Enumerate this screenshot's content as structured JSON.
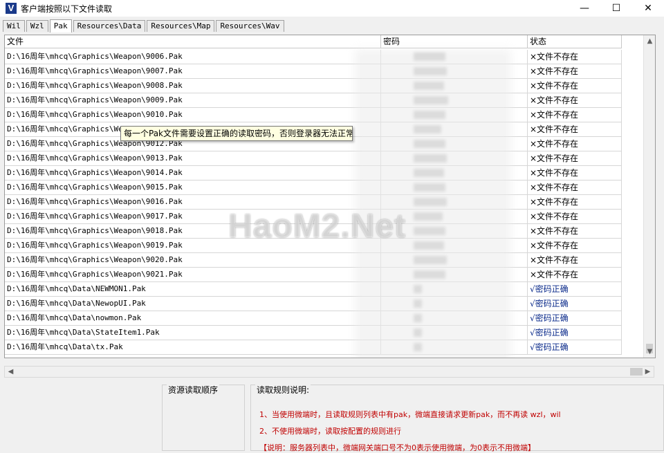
{
  "window": {
    "icon_letter": "V",
    "title": "客户端按照以下文件读取",
    "minimize": "—",
    "maximize": "☐",
    "close": "✕"
  },
  "tabs": [
    {
      "label": "Wil",
      "active": false
    },
    {
      "label": "Wzl",
      "active": false
    },
    {
      "label": "Pak",
      "active": true
    },
    {
      "label": "Resources\\Data",
      "active": false
    },
    {
      "label": "Resources\\Map",
      "active": false
    },
    {
      "label": "Resources\\Wav",
      "active": false
    }
  ],
  "table": {
    "columns": [
      "文件",
      "密码",
      "状态"
    ],
    "rows": [
      {
        "file": "D:\\16周年\\mhcq\\Graphics\\Weapon\\9006.Pak",
        "status": "×文件不存在"
      },
      {
        "file": "D:\\16周年\\mhcq\\Graphics\\Weapon\\9007.Pak",
        "status": "×文件不存在"
      },
      {
        "file": "D:\\16周年\\mhcq\\Graphics\\Weapon\\9008.Pak",
        "status": "×文件不存在"
      },
      {
        "file": "D:\\16周年\\mhcq\\Graphics\\Weapon\\9009.Pak",
        "status": "×文件不存在"
      },
      {
        "file": "D:\\16周年\\mhcq\\Graphics\\Weapon\\9010.Pak",
        "status": "×文件不存在"
      },
      {
        "file": "D:\\16周年\\mhcq\\Graphics\\Weapon\\9011.Pak",
        "status": "×文件不存在"
      },
      {
        "file": "D:\\16周年\\mhcq\\Graphics\\Weapon\\9012.Pak",
        "status": "×文件不存在"
      },
      {
        "file": "D:\\16周年\\mhcq\\Graphics\\Weapon\\9013.Pak",
        "status": "×文件不存在"
      },
      {
        "file": "D:\\16周年\\mhcq\\Graphics\\Weapon\\9014.Pak",
        "status": "×文件不存在"
      },
      {
        "file": "D:\\16周年\\mhcq\\Graphics\\Weapon\\9015.Pak",
        "status": "×文件不存在"
      },
      {
        "file": "D:\\16周年\\mhcq\\Graphics\\Weapon\\9016.Pak",
        "status": "×文件不存在"
      },
      {
        "file": "D:\\16周年\\mhcq\\Graphics\\Weapon\\9017.Pak",
        "status": "×文件不存在"
      },
      {
        "file": "D:\\16周年\\mhcq\\Graphics\\Weapon\\9018.Pak",
        "status": "×文件不存在"
      },
      {
        "file": "D:\\16周年\\mhcq\\Graphics\\Weapon\\9019.Pak",
        "status": "×文件不存在"
      },
      {
        "file": "D:\\16周年\\mhcq\\Graphics\\Weapon\\9020.Pak",
        "status": "×文件不存在"
      },
      {
        "file": "D:\\16周年\\mhcq\\Graphics\\Weapon\\9021.Pak",
        "status": "×文件不存在"
      },
      {
        "file": "D:\\16周年\\mhcq\\Data\\NEWMON1.Pak",
        "status": "√密码正确"
      },
      {
        "file": "D:\\16周年\\mhcq\\Data\\NewopUI.Pak",
        "status": "√密码正确"
      },
      {
        "file": "D:\\16周年\\mhcq\\Data\\nowmon.Pak",
        "status": "√密码正确"
      },
      {
        "file": "D:\\16周年\\mhcq\\Data\\StateItem1.Pak",
        "status": "√密码正确"
      },
      {
        "file": "D:\\16周年\\mhcq\\Data\\tx.Pak",
        "status": "√密码正确"
      }
    ]
  },
  "tooltip": "每一个Pak文件需要设置正确的读取密码，否则登录器无法正常",
  "watermark": "HaoM2.Net",
  "scroll": {
    "up": "▲",
    "down": "▼",
    "left": "◀",
    "right": "▶"
  },
  "bottom": {
    "order_group_label": "资源读取顺序",
    "rules_group_label": "读取规则说明:",
    "rules": [
      "1、当使用微端时，且读取规则列表中有pak，微端直接请求更新pak，而不再读 wzl，wil",
      "2、不使用微端时，读取按配置的规则进行",
      "【说明：服务器列表中，微端网关端口号不为0表示使用微端，为0表示不用微端】"
    ]
  },
  "colors": {
    "status_ok": "#0a2a8a",
    "rule_text": "#c00000",
    "tooltip_bg": "#ffffe1"
  }
}
